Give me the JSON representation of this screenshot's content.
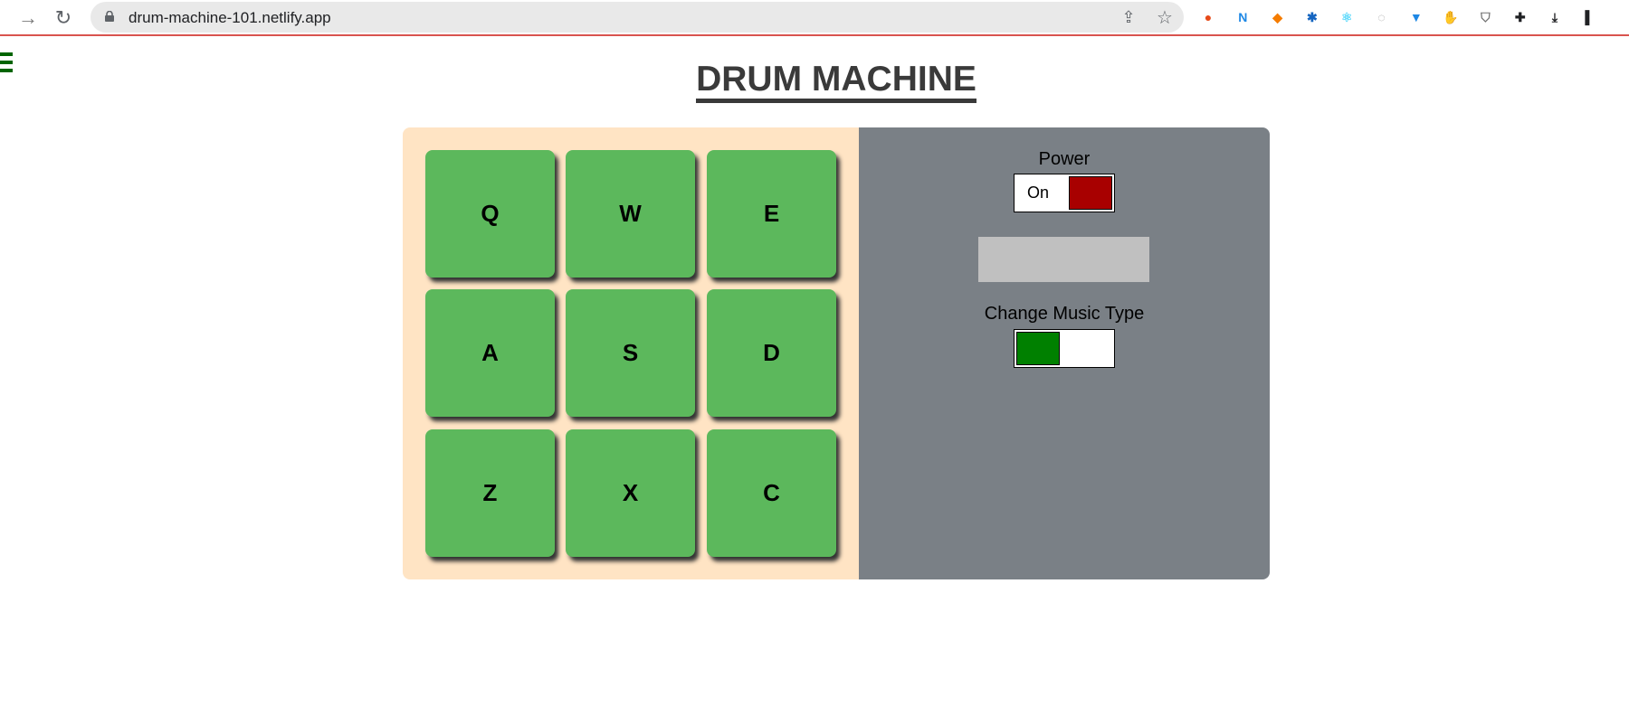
{
  "browser": {
    "url": "drum-machine-101.netlify.app",
    "forward_glyph": "→",
    "reload_glyph": "↻",
    "share_glyph": "⇪",
    "star_glyph": "☆",
    "extensions": [
      {
        "name": "color-wheel-extension-icon",
        "glyph": "●",
        "color": "#e64a19"
      },
      {
        "name": "n-extension-icon",
        "glyph": "N",
        "color": "#1e88e5"
      },
      {
        "name": "fox-extension-icon",
        "glyph": "◆",
        "color": "#f57c00"
      },
      {
        "name": "blue-gear-extension-icon",
        "glyph": "✱",
        "color": "#1565c0"
      },
      {
        "name": "react-devtools-icon",
        "glyph": "⚛",
        "color": "#61dafb"
      },
      {
        "name": "grey-circle-extension-icon",
        "glyph": "◌",
        "color": "#9e9e9e"
      },
      {
        "name": "shield-v-extension-icon",
        "glyph": "▼",
        "color": "#1e88e5"
      },
      {
        "name": "stop-hand-extension-icon",
        "glyph": "✋",
        "color": "#d50000"
      },
      {
        "name": "shield-grey-extension-icon",
        "glyph": "⛉",
        "color": "#757575"
      },
      {
        "name": "puzzle-extensions-icon",
        "glyph": "✚",
        "color": "#202124"
      },
      {
        "name": "download-icon",
        "glyph": "⤓",
        "color": "#202124"
      },
      {
        "name": "sidebar-icon",
        "glyph": "▌",
        "color": "#202124"
      }
    ]
  },
  "page": {
    "title": "DRUM MACHINE",
    "menu_color": "#006400"
  },
  "pads": {
    "keys": [
      "Q",
      "W",
      "E",
      "A",
      "S",
      "D",
      "Z",
      "X",
      "C"
    ],
    "color": "#5cb85c",
    "bank_background": "#ffe4c4"
  },
  "controls": {
    "background": "#7a8086",
    "power_label": "Power",
    "power_state": "On",
    "power_knob_color": "#a80000",
    "display_text": "",
    "display_background": "#c0c0c0",
    "music_type_label": "Change Music Type",
    "music_type_knob_color": "#008000"
  }
}
